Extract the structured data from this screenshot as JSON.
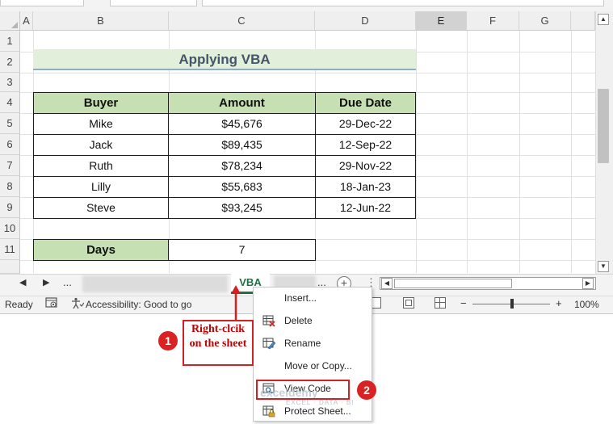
{
  "columns": [
    "A",
    "B",
    "C",
    "D",
    "E",
    "F",
    "G"
  ],
  "rows": [
    "1",
    "2",
    "3",
    "4",
    "5",
    "6",
    "7",
    "8",
    "9",
    "10",
    "11"
  ],
  "sheet_title": "Applying VBA",
  "table": {
    "headers": [
      "Buyer",
      "Amount",
      "Due Date"
    ],
    "rows": [
      [
        "Mike",
        "$45,676",
        "29-Dec-22"
      ],
      [
        "Jack",
        "$89,435",
        "12-Sep-22"
      ],
      [
        "Ruth",
        "$78,234",
        "29-Nov-22"
      ],
      [
        "Lilly",
        "$55,683",
        "18-Jan-23"
      ],
      [
        "Steve",
        "$93,245",
        "12-Jun-22"
      ]
    ]
  },
  "days": {
    "label": "Days",
    "value": "7"
  },
  "tabs": {
    "nav_ellipsis": "...",
    "active": "VBA",
    "more": "...",
    "add": "+"
  },
  "status": {
    "ready": "Ready",
    "accessibility": "Accessibility: Good to go",
    "zoom_minus": "−",
    "zoom_plus": "+",
    "zoom": "100%"
  },
  "context_menu": {
    "items": [
      "Insert...",
      "Delete",
      "Rename",
      "Move or Copy...",
      "View Code",
      "Protect Sheet..."
    ]
  },
  "annotations": {
    "step1": "1",
    "step1_text": "Right-clcik on the sheet",
    "step2": "2"
  },
  "watermark": {
    "brand": "exceldemy",
    "tagline": "EXCEL · DATA · BI"
  },
  "colors": {
    "header_green": "#c6e0b4",
    "title_bg": "#e2efda",
    "title_text": "#44546a",
    "active_tab": "#1e7145",
    "annotation_red": "#d32020"
  }
}
